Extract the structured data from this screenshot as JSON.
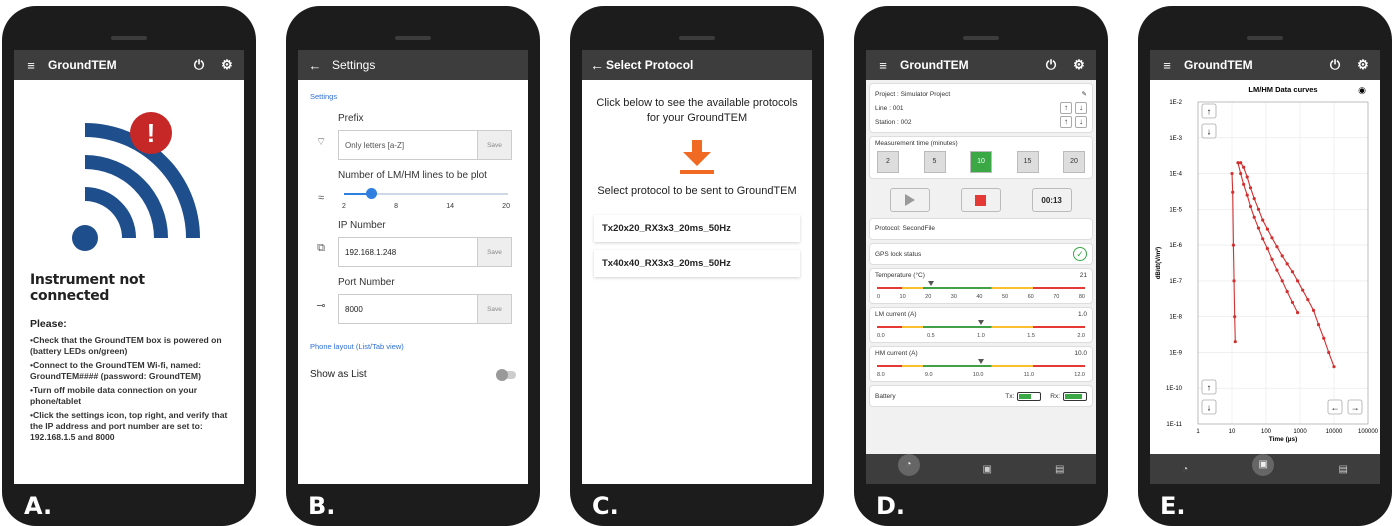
{
  "labels": {
    "a": "A.",
    "b": "B.",
    "c": "C.",
    "d": "D.",
    "e": "E."
  },
  "app_name": "GroundTEM",
  "phone_a": {
    "heading": "Instrument not connected",
    "please": "Please:",
    "bullets": [
      "•Check that the GroundTEM box is powered on (battery LEDs on/green)",
      "•Connect to the GroundTEM Wi-fi, named: GroundTEM#### (password: GroundTEM)",
      "•Turn off mobile data connection on your phone/tablet",
      "•Click the settings icon, top right, and verify that the IP address and port number are set to: 192.168.1.5 and 8000"
    ],
    "alert_symbol": "!"
  },
  "phone_b": {
    "title": "Settings",
    "section": "Settings",
    "prefix_label": "Prefix",
    "prefix_placeholder": "Only letters [a-Z]",
    "save": "Save",
    "lines_label": "Number of LM/HM lines to be plot",
    "slider_ticks": [
      "2",
      "8",
      "14",
      "20"
    ],
    "slider_value": 5,
    "slider_min": 2,
    "slider_max": 20,
    "ip_label": "IP Number",
    "ip_value": "192.168.1.248",
    "port_label": "Port Number",
    "port_value": "8000",
    "layout_section": "Phone layout (List/Tab view)",
    "show_as_list": "Show as List"
  },
  "phone_c": {
    "title": "Select Protocol",
    "intro": "Click below to see the available protocols for your GroundTEM",
    "select_text": "Select protocol to be sent to GroundTEM",
    "protocols": [
      "Tx20x20_RX3x3_20ms_50Hz",
      "Tx40x40_RX3x3_20ms_50Hz"
    ]
  },
  "phone_d": {
    "project": "Project : Simulator Project",
    "line": "Line : 001",
    "station": "Station : 002",
    "meas_label": "Measurement time (minutes)",
    "meas_options": [
      "2",
      "5",
      "10",
      "15",
      "20"
    ],
    "meas_selected": "10",
    "timer": "00:13",
    "protocol": "Protocol: SecondFile",
    "gps": "GPS lock status",
    "temperature_label": "Temperature (°C)",
    "temperature_value": "21",
    "temperature_ticks": [
      "0",
      "10",
      "20",
      "30",
      "40",
      "50",
      "60",
      "70",
      "80"
    ],
    "temperature_level": 0.26,
    "lm_label": "LM current (A)",
    "lm_value": "1.0",
    "lm_ticks": [
      "0.0",
      "0.5",
      "1.0",
      "1.5",
      "2.0"
    ],
    "lm_level": 0.5,
    "hm_label": "HM current (A)",
    "hm_value": "10.0",
    "hm_ticks": [
      "8.0",
      "9.0",
      "10.0",
      "11.0",
      "12.0"
    ],
    "hm_level": 0.5,
    "battery_label": "Battery",
    "tx_label": "Tx:",
    "rx_label": "Rx:",
    "tx_level": 0.6,
    "rx_level": 0.85
  },
  "phone_e": {
    "chart_data": {
      "type": "line",
      "title": "LM/HM Data curves",
      "xlabel": "Time (µs)",
      "ylabel": "dB/dt(V/m²)",
      "xscale": "log",
      "yscale": "log",
      "xlim": [
        1,
        100000
      ],
      "ylim": [
        1e-11,
        0.01
      ],
      "x_ticks": [
        "1",
        "10",
        "100",
        "1000",
        "10000",
        "100000"
      ],
      "y_ticks": [
        "1E-2",
        "1E-3",
        "1E-4",
        "1E-5",
        "1E-6",
        "1E-7",
        "1E-8",
        "1E-9",
        "1E-10",
        "1E-11"
      ],
      "series": [
        {
          "color": "#d32f2f",
          "x": [
            10,
            10.5,
            11,
            11.5,
            12,
            12.5
          ],
          "y": [
            0.0001,
            3e-05,
            1e-06,
            1e-07,
            1e-08,
            2e-09
          ]
        },
        {
          "color": "#d32f2f",
          "x": [
            15,
            18,
            22,
            28,
            35,
            45,
            60,
            80,
            110,
            150,
            210,
            300,
            420,
            600,
            850
          ],
          "y": [
            0.0002,
            0.0001,
            5e-05,
            2.5e-05,
            1.2e-05,
            6e-06,
            3e-06,
            1.5e-06,
            8e-07,
            4e-07,
            2e-07,
            1e-07,
            5e-08,
            2.5e-08,
            1.3e-08
          ]
        },
        {
          "color": "#d32f2f",
          "x": [
            18,
            22,
            28,
            35,
            45,
            60,
            80,
            110,
            150,
            210,
            300,
            420,
            600,
            850,
            1200,
            1700,
            2500,
            3500,
            5000,
            7000,
            10000
          ],
          "y": [
            0.0002,
            0.00015,
            8e-05,
            4e-05,
            2e-05,
            1e-05,
            5e-06,
            2.8e-06,
            1.6e-06,
            9e-07,
            5e-07,
            3e-07,
            1.8e-07,
            1e-07,
            5.5e-08,
            3e-08,
            1.5e-08,
            6e-09,
            2.5e-09,
            1e-09,
            4e-10
          ]
        }
      ]
    }
  }
}
